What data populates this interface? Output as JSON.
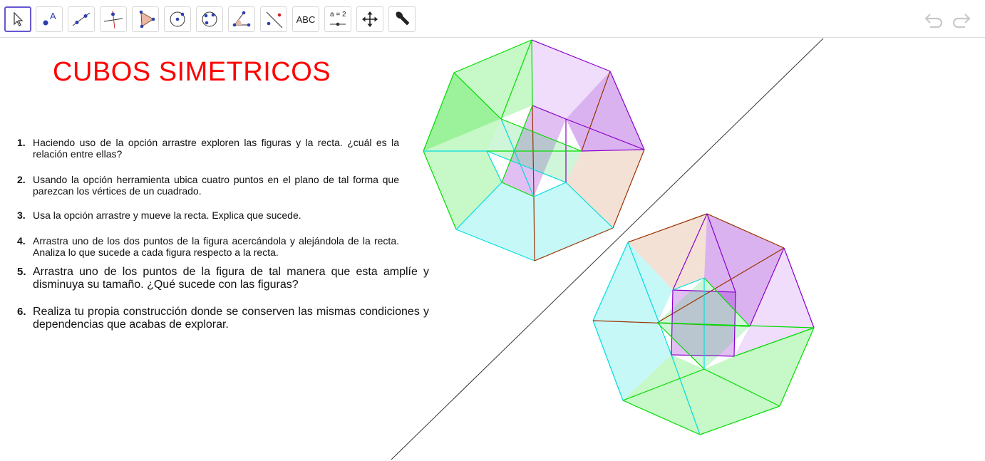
{
  "toolbar": {
    "tools": [
      {
        "name": "move-tool",
        "icon": "arrow-cursor-icon"
      },
      {
        "name": "point-tool",
        "icon": "point-icon",
        "label": "A"
      },
      {
        "name": "line-tool",
        "icon": "line-through-points-icon"
      },
      {
        "name": "perpendicular-line-tool",
        "icon": "perpendicular-line-icon"
      },
      {
        "name": "polygon-tool",
        "icon": "polygon-icon"
      },
      {
        "name": "circle-center-point-tool",
        "icon": "circle-center-icon"
      },
      {
        "name": "circle-three-points-tool",
        "icon": "circle-three-points-icon"
      },
      {
        "name": "angle-tool",
        "icon": "angle-icon"
      },
      {
        "name": "reflect-line-tool",
        "icon": "reflect-about-line-icon"
      },
      {
        "name": "text-tool",
        "icon": "text-icon",
        "label": "ABC"
      },
      {
        "name": "slider-tool",
        "icon": "slider-icon",
        "label": "a = 2"
      },
      {
        "name": "move-graphics-view-tool",
        "icon": "move-view-icon"
      },
      {
        "name": "tools-button",
        "icon": "wrench-icon"
      }
    ],
    "undo_icon": "undo-icon",
    "redo_icon": "redo-icon"
  },
  "title": "CUBOS SIMETRICOS",
  "instructions": [
    {
      "num": "1.",
      "text": "Haciendo uso de la opción arrastre exploren las figuras y la recta. ¿cuál es la relación entre ellas?"
    },
    {
      "num": "2.",
      "text": "Usando la opción herramienta ubica cuatro puntos en el plano de tal forma que parezcan los vértices de un cuadrado."
    },
    {
      "num": "3.",
      "text": "Usa la opción arrastre y mueve la recta. Explica que sucede."
    },
    {
      "num": "4.",
      "text": "Arrastra uno de los dos puntos de la figura acercándola y alejándola de la recta. Analiza lo que sucede a cada figura respecto a la recta."
    },
    {
      "num": "5.",
      "text": "Arrastra uno de los puntos de la figura de tal manera que esta amplíe y disminuya su tamaño. ¿Qué sucede con las figuras?"
    },
    {
      "num": "6.",
      "text": "Realiza tu propia construcción donde se conserven las mismas condiciones y dependencias que acabas de explorar."
    }
  ],
  "colors": {
    "title": "#ff0000",
    "accent": "#6557d2",
    "green": "#00dd00",
    "cyan": "#00dddd",
    "purple": "#8800cc",
    "brown": "#993300"
  }
}
